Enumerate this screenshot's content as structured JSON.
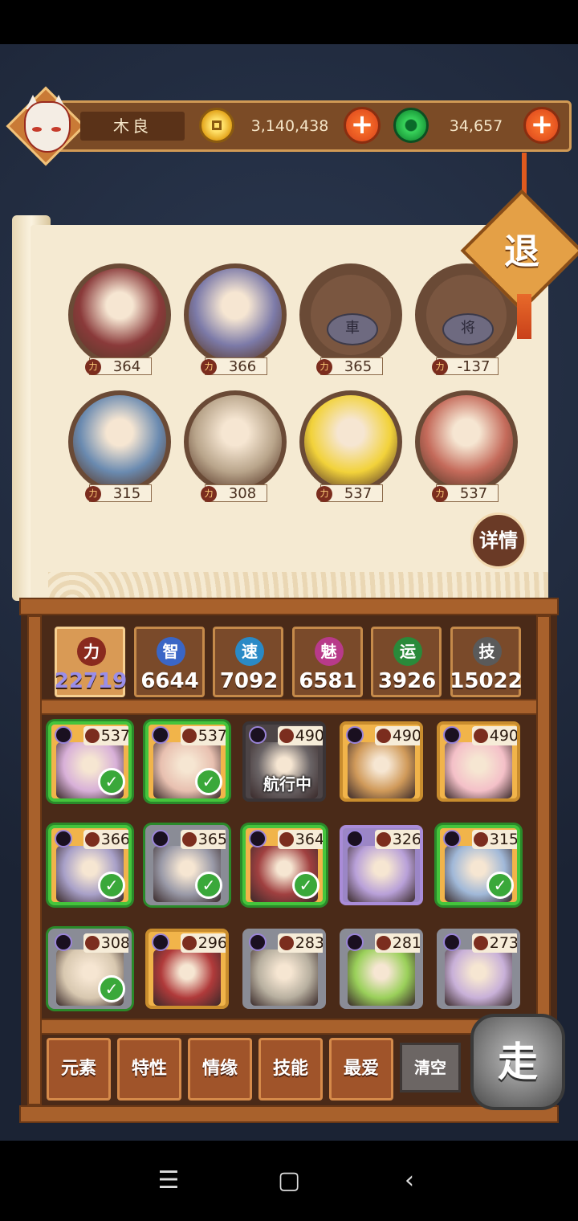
{
  "player": {
    "name": "木良"
  },
  "currency": {
    "gold": "3,140,438",
    "jade": "34,657"
  },
  "buttons": {
    "retreat": "退",
    "detail": "详情",
    "go": "走",
    "clear": "清空"
  },
  "lineup": [
    {
      "power": "364",
      "kind": "hero",
      "color": "#8a3a3a"
    },
    {
      "power": "366",
      "kind": "hero",
      "color": "#7c7aa8"
    },
    {
      "power": "365",
      "kind": "chess",
      "piece": "車"
    },
    {
      "power": "-137",
      "kind": "chess",
      "piece": "将"
    },
    {
      "power": "315",
      "kind": "hero",
      "color": "#6a8ab0"
    },
    {
      "power": "308",
      "kind": "hero",
      "color": "#b8a48a"
    },
    {
      "power": "537",
      "kind": "hero",
      "color": "#f2d23a"
    },
    {
      "power": "537",
      "kind": "hero",
      "color": "#c46a5a"
    }
  ],
  "stats": [
    {
      "icon": "力",
      "value": "22719",
      "color": "#8a2a1e",
      "active": true
    },
    {
      "icon": "智",
      "value": "6644",
      "color": "#3a66c6",
      "active": false
    },
    {
      "icon": "速",
      "value": "7092",
      "color": "#2a8ac6",
      "active": false
    },
    {
      "icon": "魅",
      "value": "6581",
      "color": "#b83a8a",
      "active": false
    },
    {
      "icon": "运",
      "value": "3926",
      "color": "#2a8a3a",
      "active": false
    },
    {
      "icon": "技",
      "value": "15022",
      "color": "#5a5a5a",
      "active": false
    }
  ],
  "roster": [
    {
      "power": "537",
      "style": "gold",
      "selected": true,
      "art": "#d8b0d8"
    },
    {
      "power": "537",
      "style": "gold",
      "selected": true,
      "art": "#e8c0b0"
    },
    {
      "power": "490",
      "style": "dark",
      "selected": false,
      "art": "#6a6466",
      "label": "航行中"
    },
    {
      "power": "490",
      "style": "gold",
      "selected": false,
      "art": "#d09a5a"
    },
    {
      "power": "490",
      "style": "gold",
      "selected": false,
      "art": "#f4c0c8"
    },
    {
      "power": "366",
      "style": "gold",
      "selected": true,
      "art": "#a8a0c8"
    },
    {
      "power": "365",
      "style": "gray",
      "selected": true,
      "art": "#9a9aa8"
    },
    {
      "power": "364",
      "style": "gold",
      "selected": true,
      "art": "#a04040"
    },
    {
      "power": "326",
      "style": "purple",
      "selected": false,
      "art": "#b8a0d8"
    },
    {
      "power": "315",
      "style": "gold",
      "selected": true,
      "art": "#a0b8d8"
    },
    {
      "power": "308",
      "style": "gray",
      "selected": true,
      "art": "#d8c8b0"
    },
    {
      "power": "296",
      "style": "gold",
      "selected": false,
      "art": "#b03a3a"
    },
    {
      "power": "283",
      "style": "gray",
      "selected": false,
      "art": "#b8b0a0"
    },
    {
      "power": "281",
      "style": "gray",
      "selected": false,
      "art": "#9ad05a"
    },
    {
      "power": "273",
      "style": "gray",
      "selected": false,
      "art": "#c8b0d8"
    }
  ],
  "filters": [
    "元素",
    "特性",
    "情缘",
    "技能",
    "最爱"
  ]
}
